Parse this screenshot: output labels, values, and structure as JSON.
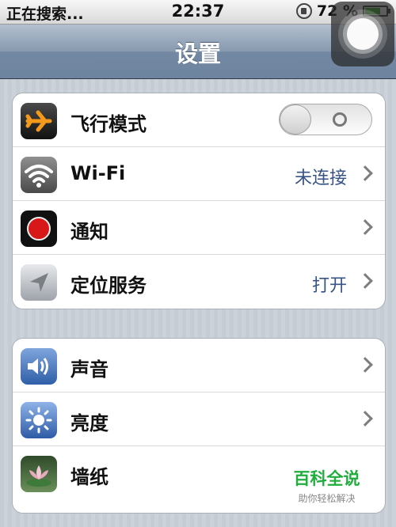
{
  "status_bar": {
    "carrier_text": "正在搜索...",
    "time": "22:37",
    "battery_percent": "72 %",
    "battery_level": 0.72
  },
  "nav": {
    "title": "设置"
  },
  "groups": [
    {
      "rows": [
        {
          "label": "飞行模式",
          "icon": "airplane-icon",
          "toggle": "off"
        },
        {
          "label": "Wi-Fi",
          "icon": "wifi-icon",
          "value": "未连接"
        },
        {
          "label": "通知",
          "icon": "notifications-icon"
        },
        {
          "label": "定位服务",
          "icon": "location-icon",
          "value": "打开"
        }
      ]
    },
    {
      "rows": [
        {
          "label": "声音",
          "icon": "sound-icon"
        },
        {
          "label": "亮度",
          "icon": "brightness-icon"
        },
        {
          "label": "墙纸",
          "icon": "wallpaper-icon"
        }
      ]
    }
  ],
  "watermark": {
    "main": "百科全说",
    "sub": "助你轻松解决"
  },
  "colors": {
    "nav_blue": "#7388a2",
    "value_blue": "#385487",
    "notification_red": "#d81818",
    "battery_green": "#3aa12a",
    "watermark_green": "#1fae3c"
  }
}
